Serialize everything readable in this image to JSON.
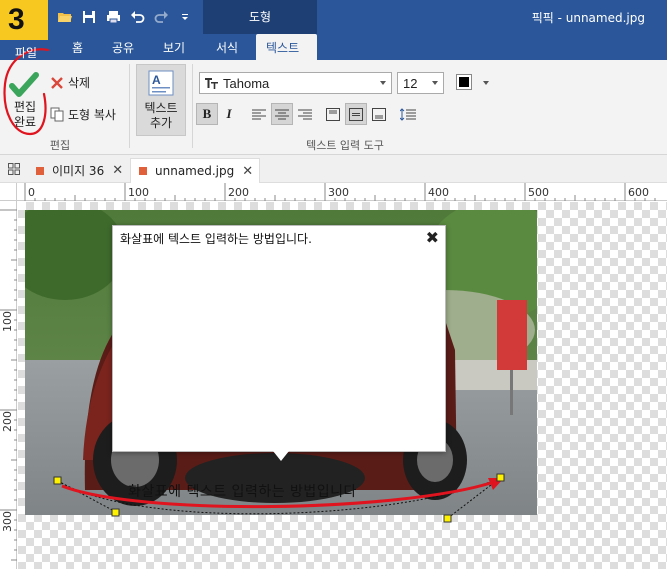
{
  "step_badge": "3",
  "app_title": "픽픽 - unnamed.jpg",
  "context_group": "도형",
  "tabs": [
    "파일",
    "홈",
    "공유",
    "보기",
    "서식",
    "텍스트"
  ],
  "active_tab": "텍스트",
  "ribbon": {
    "done_label": [
      "편집",
      "완료"
    ],
    "delete_label": "삭제",
    "copy_shape_label": "도형 복사",
    "edit_group_label": "편집",
    "text_add_label": [
      "텍스트",
      "추가"
    ],
    "font": "Tahoma",
    "font_size": "12",
    "text_tools_group_label": "텍스트 입력 도구",
    "bold": "B",
    "italic": "I"
  },
  "doc_tabs": [
    {
      "label": "이미지 36",
      "close": "✕"
    },
    {
      "label": "unnamed.jpg",
      "close": "✕"
    }
  ],
  "ruler": {
    "top": [
      "0",
      "100",
      "200",
      "300",
      "400",
      "500",
      "600"
    ],
    "left": [
      "100",
      "200",
      "300"
    ]
  },
  "editor": {
    "text": "화살표에 텍스트 입력하는 방법입니다.",
    "close": "✖"
  },
  "caption": "화살표에 텍스트 입력하는 방법입니다",
  "colors": {
    "brand_blue": "#2b579a",
    "context_blue": "#1e3f74",
    "badge_yellow": "#f7c81f",
    "annotation_red": "#e0141e",
    "check_green": "#3ba55c"
  },
  "icons": [
    "folder-open-icon",
    "save-icon",
    "print-icon",
    "undo-icon",
    "redo-icon",
    "customize-qat-icon",
    "checkmark-icon",
    "delete-x-icon",
    "copy-shape-icon",
    "text-add-icon",
    "font-type-icon",
    "align-left-icon",
    "align-center-icon",
    "align-right-icon",
    "valign-top-icon",
    "valign-middle-icon",
    "valign-bottom-icon",
    "line-spacing-icon",
    "color-swatch-icon",
    "grid-icon",
    "close-icon"
  ]
}
